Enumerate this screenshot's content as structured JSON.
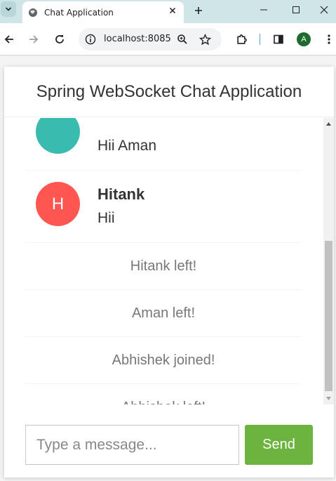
{
  "browser": {
    "tab_title": "Chat Application",
    "url": "localhost:8085",
    "profile_initial": "A",
    "tab_list_icon": "chevron-down-icon",
    "accent_color": "#cfe5e7"
  },
  "chat": {
    "title": "Spring WebSocket Chat Application",
    "messages": [
      {
        "type": "chat",
        "sender": "",
        "initial": "",
        "text": "Hii Aman",
        "avatar_color": "#39bbb0"
      },
      {
        "type": "chat",
        "sender": "Hitank",
        "initial": "H",
        "text": "Hii",
        "avatar_color": "#ff5652"
      },
      {
        "type": "event",
        "text": "Hitank left!"
      },
      {
        "type": "event",
        "text": "Aman left!"
      },
      {
        "type": "event",
        "text": "Abhishek joined!"
      },
      {
        "type": "event",
        "text": "Abhishek left!"
      }
    ],
    "input_placeholder": "Type a message...",
    "send_label": "Send",
    "send_color": "#6db33f"
  }
}
